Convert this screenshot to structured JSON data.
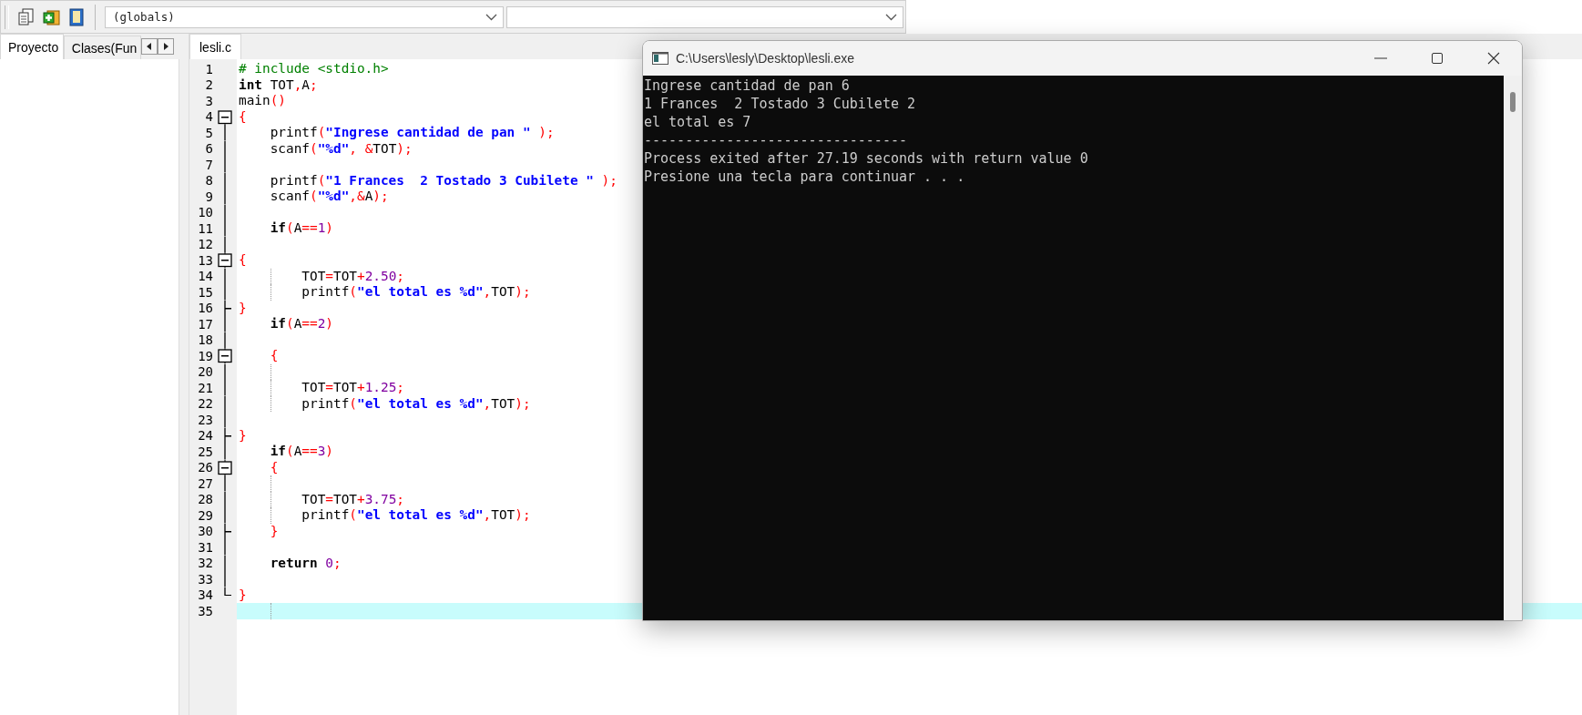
{
  "toolbar": {
    "scope_combo": {
      "value": "(globals)"
    }
  },
  "sidebar": {
    "tabs": [
      {
        "label": "Proyecto",
        "selected": true
      },
      {
        "label": "Clases(Fun",
        "selected": false
      }
    ]
  },
  "editor": {
    "tabs": [
      {
        "label": "lesli.c",
        "selected": true
      }
    ],
    "lines": [
      {
        "number": "1",
        "selected": false,
        "fold_start": false,
        "fold_end": false,
        "guide": false,
        "tokens": [
          {
            "kind": "pp",
            "text": "# include <stdio.h>"
          }
        ]
      },
      {
        "number": "2",
        "selected": false,
        "fold_start": false,
        "fold_end": false,
        "guide": false,
        "tokens": [
          {
            "kind": "kw",
            "text": "int"
          },
          {
            "kind": "id",
            "text": " TOT"
          },
          {
            "kind": "sym",
            "text": ","
          },
          {
            "kind": "id",
            "text": "A"
          },
          {
            "kind": "sym",
            "text": ";"
          }
        ]
      },
      {
        "number": "3",
        "selected": false,
        "fold_start": false,
        "fold_end": false,
        "guide": false,
        "tokens": [
          {
            "kind": "id",
            "text": "main"
          },
          {
            "kind": "sym",
            "text": "()"
          }
        ]
      },
      {
        "number": "4",
        "selected": false,
        "fold_start": true,
        "fold_end": false,
        "guide": false,
        "tokens": [
          {
            "kind": "sym",
            "text": "{"
          }
        ]
      },
      {
        "number": "5",
        "selected": false,
        "fold_start": false,
        "fold_end": false,
        "guide": false,
        "tokens": [
          {
            "kind": "id",
            "text": "    printf"
          },
          {
            "kind": "sym",
            "text": "("
          },
          {
            "kind": "str",
            "text": "\"Ingrese cantidad de pan \""
          },
          {
            "kind": "sym",
            "text": " );"
          }
        ]
      },
      {
        "number": "6",
        "selected": false,
        "fold_start": false,
        "fold_end": false,
        "guide": false,
        "tokens": [
          {
            "kind": "id",
            "text": "    scanf"
          },
          {
            "kind": "sym",
            "text": "("
          },
          {
            "kind": "str",
            "text": "\"%d\""
          },
          {
            "kind": "sym",
            "text": ", &"
          },
          {
            "kind": "id",
            "text": "TOT"
          },
          {
            "kind": "sym",
            "text": ");"
          }
        ]
      },
      {
        "number": "7",
        "selected": false,
        "fold_start": false,
        "fold_end": false,
        "guide": false
      },
      {
        "number": "8",
        "selected": false,
        "fold_start": false,
        "fold_end": false,
        "guide": false,
        "tokens": [
          {
            "kind": "id",
            "text": "    printf"
          },
          {
            "kind": "sym",
            "text": "("
          },
          {
            "kind": "str",
            "text": "\"1 Frances  2 Tostado 3 Cubilete \""
          },
          {
            "kind": "sym",
            "text": " );"
          }
        ]
      },
      {
        "number": "9",
        "selected": false,
        "fold_start": false,
        "fold_end": false,
        "guide": false,
        "tokens": [
          {
            "kind": "id",
            "text": "    scanf"
          },
          {
            "kind": "sym",
            "text": "("
          },
          {
            "kind": "str",
            "text": "\"%d\""
          },
          {
            "kind": "sym",
            "text": ",&"
          },
          {
            "kind": "id",
            "text": "A"
          },
          {
            "kind": "sym",
            "text": ");"
          }
        ]
      },
      {
        "number": "10",
        "selected": false,
        "fold_start": false,
        "fold_end": false,
        "guide": false
      },
      {
        "number": "11",
        "selected": false,
        "fold_start": false,
        "fold_end": false,
        "guide": false,
        "tokens": [
          {
            "kind": "kw",
            "text": "    if"
          },
          {
            "kind": "sym",
            "text": "("
          },
          {
            "kind": "id",
            "text": "A"
          },
          {
            "kind": "sym",
            "text": "=="
          },
          {
            "kind": "num",
            "text": "1"
          },
          {
            "kind": "sym",
            "text": ")"
          }
        ]
      },
      {
        "number": "12",
        "selected": false,
        "fold_start": false,
        "fold_end": false,
        "guide": false
      },
      {
        "number": "13",
        "selected": false,
        "fold_start": true,
        "fold_end": false,
        "guide": false,
        "tokens": [
          {
            "kind": "sym",
            "text": "{"
          }
        ]
      },
      {
        "number": "14",
        "selected": false,
        "fold_start": false,
        "fold_end": false,
        "guide": true,
        "tokens": [
          {
            "kind": "id",
            "text": "        TOT"
          },
          {
            "kind": "sym",
            "text": "="
          },
          {
            "kind": "id",
            "text": "TOT"
          },
          {
            "kind": "sym",
            "text": "+"
          },
          {
            "kind": "num",
            "text": "2.50"
          },
          {
            "kind": "sym",
            "text": ";"
          }
        ]
      },
      {
        "number": "15",
        "selected": false,
        "fold_start": false,
        "fold_end": false,
        "guide": true,
        "tokens": [
          {
            "kind": "id",
            "text": "        printf"
          },
          {
            "kind": "sym",
            "text": "("
          },
          {
            "kind": "str",
            "text": "\"el total es %d\""
          },
          {
            "kind": "sym",
            "text": ","
          },
          {
            "kind": "id",
            "text": "TOT"
          },
          {
            "kind": "sym",
            "text": ");"
          }
        ]
      },
      {
        "number": "16",
        "selected": false,
        "fold_start": false,
        "fold_end": true,
        "guide": false,
        "tokens": [
          {
            "kind": "sym",
            "text": "}"
          }
        ]
      },
      {
        "number": "17",
        "selected": false,
        "fold_start": false,
        "fold_end": false,
        "guide": false,
        "tokens": [
          {
            "kind": "kw",
            "text": "    if"
          },
          {
            "kind": "sym",
            "text": "("
          },
          {
            "kind": "id",
            "text": "A"
          },
          {
            "kind": "sym",
            "text": "=="
          },
          {
            "kind": "num",
            "text": "2"
          },
          {
            "kind": "sym",
            "text": ")"
          }
        ]
      },
      {
        "number": "18",
        "selected": false,
        "fold_start": false,
        "fold_end": false,
        "guide": false
      },
      {
        "number": "19",
        "selected": false,
        "fold_start": true,
        "fold_end": false,
        "guide": false,
        "tokens": [
          {
            "kind": "sym",
            "text": "    {"
          }
        ]
      },
      {
        "number": "20",
        "selected": false,
        "fold_start": false,
        "fold_end": false,
        "guide": true
      },
      {
        "number": "21",
        "selected": false,
        "fold_start": false,
        "fold_end": false,
        "guide": true,
        "tokens": [
          {
            "kind": "id",
            "text": "        TOT"
          },
          {
            "kind": "sym",
            "text": "="
          },
          {
            "kind": "id",
            "text": "TOT"
          },
          {
            "kind": "sym",
            "text": "+"
          },
          {
            "kind": "num",
            "text": "1.25"
          },
          {
            "kind": "sym",
            "text": ";"
          }
        ]
      },
      {
        "number": "22",
        "selected": false,
        "fold_start": false,
        "fold_end": false,
        "guide": true,
        "tokens": [
          {
            "kind": "id",
            "text": "        printf"
          },
          {
            "kind": "sym",
            "text": "("
          },
          {
            "kind": "str",
            "text": "\"el total es %d\""
          },
          {
            "kind": "sym",
            "text": ","
          },
          {
            "kind": "id",
            "text": "TOT"
          },
          {
            "kind": "sym",
            "text": ");"
          }
        ]
      },
      {
        "number": "23",
        "selected": false,
        "fold_start": false,
        "fold_end": false,
        "guide": false
      },
      {
        "number": "24",
        "selected": false,
        "fold_start": false,
        "fold_end": true,
        "guide": false,
        "tokens": [
          {
            "kind": "sym",
            "text": "}"
          }
        ]
      },
      {
        "number": "25",
        "selected": false,
        "fold_start": false,
        "fold_end": false,
        "guide": false,
        "tokens": [
          {
            "kind": "kw",
            "text": "    if"
          },
          {
            "kind": "sym",
            "text": "("
          },
          {
            "kind": "id",
            "text": "A"
          },
          {
            "kind": "sym",
            "text": "=="
          },
          {
            "kind": "num",
            "text": "3"
          },
          {
            "kind": "sym",
            "text": ")"
          }
        ]
      },
      {
        "number": "26",
        "selected": false,
        "fold_start": true,
        "fold_end": false,
        "guide": false,
        "tokens": [
          {
            "kind": "sym",
            "text": "    {"
          }
        ]
      },
      {
        "number": "27",
        "selected": false,
        "fold_start": false,
        "fold_end": false,
        "guide": true
      },
      {
        "number": "28",
        "selected": false,
        "fold_start": false,
        "fold_end": false,
        "guide": true,
        "tokens": [
          {
            "kind": "id",
            "text": "        TOT"
          },
          {
            "kind": "sym",
            "text": "="
          },
          {
            "kind": "id",
            "text": "TOT"
          },
          {
            "kind": "sym",
            "text": "+"
          },
          {
            "kind": "num",
            "text": "3.75"
          },
          {
            "kind": "sym",
            "text": ";"
          }
        ]
      },
      {
        "number": "29",
        "selected": false,
        "fold_start": false,
        "fold_end": false,
        "guide": true,
        "tokens": [
          {
            "kind": "id",
            "text": "        printf"
          },
          {
            "kind": "sym",
            "text": "("
          },
          {
            "kind": "str",
            "text": "\"el total es %d\""
          },
          {
            "kind": "sym",
            "text": ","
          },
          {
            "kind": "id",
            "text": "TOT"
          },
          {
            "kind": "sym",
            "text": ");"
          }
        ]
      },
      {
        "number": "30",
        "selected": false,
        "fold_start": false,
        "fold_end": true,
        "guide": false,
        "tokens": [
          {
            "kind": "sym",
            "text": "    }"
          }
        ]
      },
      {
        "number": "31",
        "selected": false,
        "fold_start": false,
        "fold_end": false,
        "guide": false
      },
      {
        "number": "32",
        "selected": false,
        "fold_start": false,
        "fold_end": false,
        "guide": false,
        "tokens": [
          {
            "kind": "kw",
            "text": "    return "
          },
          {
            "kind": "num",
            "text": "0"
          },
          {
            "kind": "sym",
            "text": ";"
          }
        ]
      },
      {
        "number": "33",
        "selected": false,
        "fold_start": false,
        "fold_end": false,
        "guide": false
      },
      {
        "number": "34",
        "selected": false,
        "fold_start": false,
        "fold_end": true,
        "guide": false,
        "tokens": [
          {
            "kind": "sym",
            "text": "}"
          }
        ]
      },
      {
        "number": "35",
        "selected": true,
        "fold_start": false,
        "fold_end": false,
        "guide": true
      }
    ]
  },
  "console": {
    "title": "C:\\Users\\lesly\\Desktop\\lesli.exe",
    "lines": [
      "Ingrese cantidad de pan 6",
      "1 Frances  2 Tostado 3 Cubilete 2",
      "el total es 7",
      "--------------------------------",
      "Process exited after 27.19 seconds with return value 0",
      "Presione una tecla para continuar . . ."
    ]
  }
}
